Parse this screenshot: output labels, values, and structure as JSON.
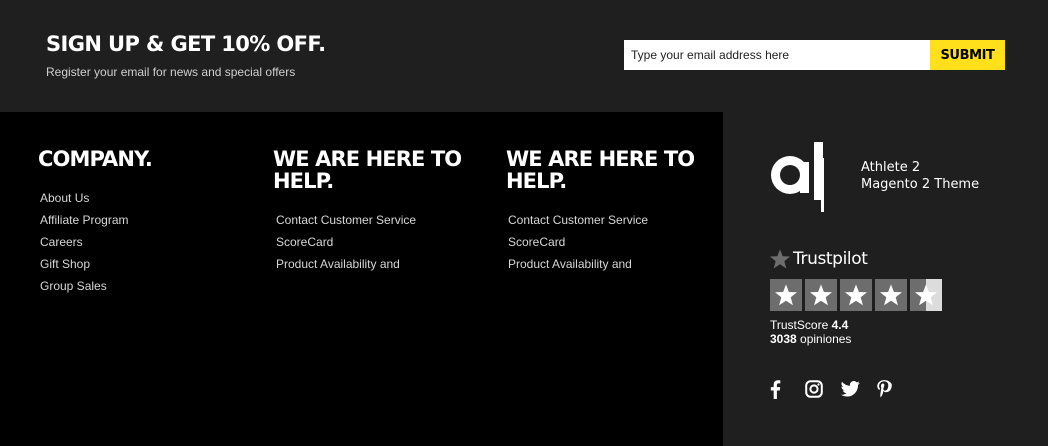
{
  "newsletter": {
    "title": "SIGN UP & GET 10% OFF.",
    "subtitle": "Register your email for news and special offers",
    "email_placeholder": "Type your email address here",
    "submit_label": "SUBMIT"
  },
  "columns": [
    {
      "heading": "COMPANY.",
      "links": [
        "About Us",
        "Affiliate Program",
        "Careers",
        "Gift Shop",
        "Group Sales"
      ]
    },
    {
      "heading": "WE ARE HERE TO HELP.",
      "links": [
        "Contact Customer Service",
        "ScoreCard",
        "Product Availability and"
      ]
    },
    {
      "heading": "WE ARE HERE TO HELP.",
      "links": [
        "Contact Customer Service",
        "ScoreCard",
        "Product Availability and"
      ]
    }
  ],
  "brand": {
    "logo_line1": "Athlete 2",
    "logo_line2": "Magento 2 Theme"
  },
  "trustpilot": {
    "name": "Trustpilot",
    "score_label": "TrustScore",
    "score": "4.4",
    "reviews_count": "3038",
    "reviews_label": "opiniones",
    "rating": 4.5,
    "star_color": "#6d6d6d"
  },
  "social": {
    "icons": [
      "facebook-icon",
      "instagram-icon",
      "twitter-icon",
      "pinterest-icon"
    ]
  },
  "colors": {
    "accent": "#ffe01b",
    "dark_panel": "#1f1f1f",
    "background": "#000000"
  }
}
